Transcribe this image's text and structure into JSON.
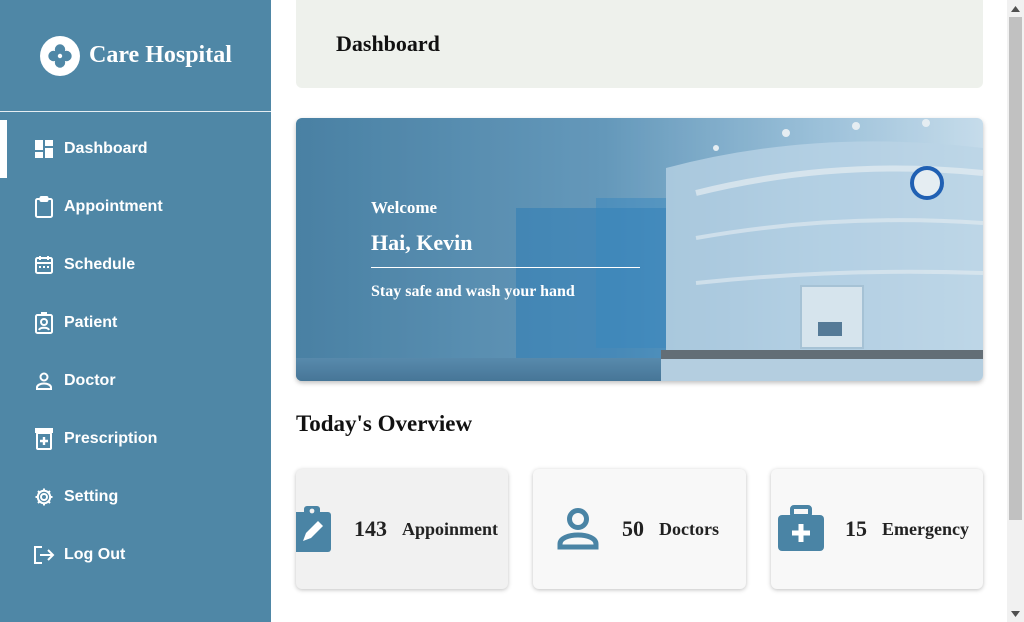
{
  "sidebar": {
    "brand": "Care Hospital",
    "items": [
      {
        "label": "Dashboard",
        "icon": "dashboard-icon",
        "active": true
      },
      {
        "label": "Appointment",
        "icon": "clipboard-icon"
      },
      {
        "label": "Schedule",
        "icon": "calendar-icon"
      },
      {
        "label": "Patient",
        "icon": "patient-badge-icon"
      },
      {
        "label": "Doctor",
        "icon": "person-icon"
      },
      {
        "label": "Prescription",
        "icon": "medicine-bottle-icon"
      },
      {
        "label": "Setting",
        "icon": "gear-icon"
      },
      {
        "label": "Log Out",
        "icon": "logout-icon"
      }
    ]
  },
  "header": {
    "title": "Dashboard"
  },
  "hero": {
    "welcome": "Welcome",
    "greeting": "Hai, Kevin",
    "subtitle": "Stay safe and wash your hand"
  },
  "overview": {
    "title": "Today's Overview",
    "cards": [
      {
        "value": "143",
        "label": "Appoinment",
        "icon": "clipboard-edit-icon"
      },
      {
        "value": "50",
        "label": "Doctors",
        "icon": "person-icon"
      },
      {
        "value": "15",
        "label": "Emergency",
        "icon": "medical-kit-icon"
      }
    ]
  },
  "colors": {
    "sidebar": "#4f87a6",
    "accent": "#4a84a5",
    "header_bg": "#eef1ec"
  }
}
